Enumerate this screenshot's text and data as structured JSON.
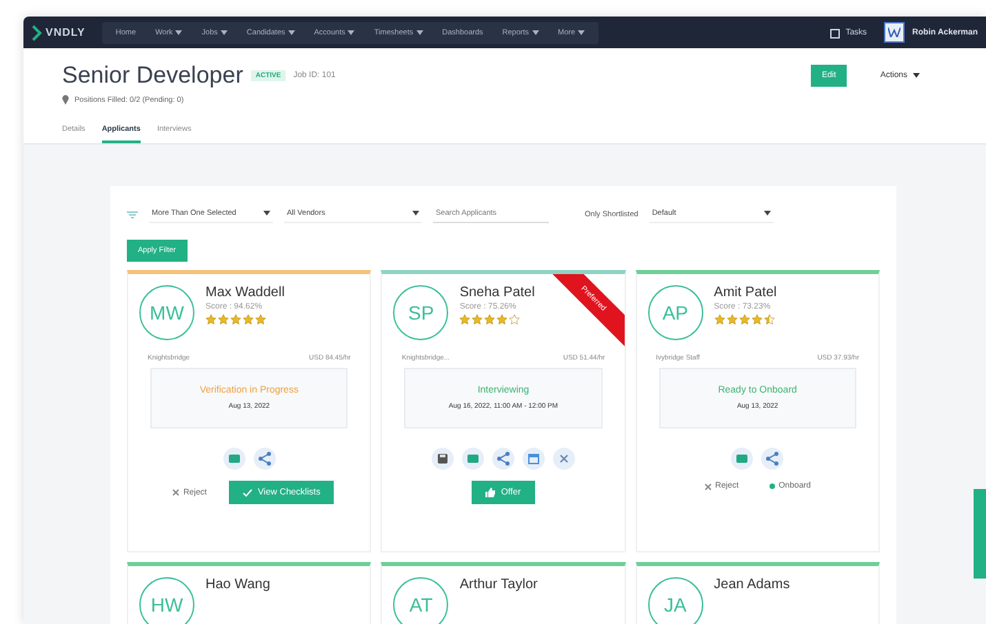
{
  "nav": {
    "logo": "VNDLY",
    "items": [
      {
        "label": "Home",
        "dropdown": false
      },
      {
        "label": "Work",
        "dropdown": true
      },
      {
        "label": "Jobs",
        "dropdown": true
      },
      {
        "label": "Candidates",
        "dropdown": true
      },
      {
        "label": "Accounts",
        "dropdown": true
      },
      {
        "label": "Timesheets",
        "dropdown": true
      },
      {
        "label": "Dashboards",
        "dropdown": false
      },
      {
        "label": "Reports",
        "dropdown": true
      },
      {
        "label": "More",
        "dropdown": true
      }
    ],
    "tasks": "Tasks",
    "user": "Robin Ackerman"
  },
  "header": {
    "title": "Senior Developer",
    "status": "ACTIVE",
    "job_id": "Job ID: 101",
    "positions": "Positions Filled: 0/2 (Pending: 0)",
    "edit": "Edit",
    "actions": "Actions"
  },
  "tabs": [
    {
      "label": "Details",
      "selected": false
    },
    {
      "label": "Applicants",
      "selected": true
    },
    {
      "label": "Interviews",
      "selected": false
    }
  ],
  "filters": {
    "statuses": "More Than One Selected",
    "vendors": "All Vendors",
    "search": {
      "placeholder": "Search Applicants"
    },
    "shortlisted": "Only Shortlisted",
    "sort": "Default",
    "apply": "Apply Filter"
  },
  "applicants": [
    {
      "initials": "MW",
      "name": "Max Waddell",
      "score": "Score : 94.62%",
      "stars": 5,
      "color": "#f5c27a",
      "location": "Knightsbridge",
      "rate": "USD 84.45/hr",
      "status": {
        "label": "Verification in Progress",
        "color": "#f0a040",
        "date": "Aug 13, 2022"
      },
      "icons": [
        {
          "kind": "email"
        },
        {
          "kind": "share"
        }
      ],
      "actions": [
        {
          "kind": "reject",
          "label": "Reject"
        },
        {
          "kind": "checklist",
          "label": "View Checklists"
        }
      ]
    },
    {
      "initials": "SP",
      "name": "Sneha Patel",
      "score": "Score : 75.26%",
      "stars": 4,
      "color": "#8fd3c3",
      "location": "Knightsbridge...",
      "rate": "USD 51.44/hr",
      "status": {
        "label": "Interviewing",
        "color": "#3cb371",
        "date": "Aug 16, 2022, 11:00 AM - 12:00 PM"
      },
      "ribbon": "Preferred",
      "icons": [
        {
          "kind": "save"
        },
        {
          "kind": "email"
        },
        {
          "kind": "share"
        },
        {
          "kind": "calendar"
        },
        {
          "kind": "close"
        }
      ],
      "actions": [
        {
          "kind": "offer",
          "label": "Offer"
        }
      ]
    },
    {
      "initials": "AP",
      "name": "Amit Patel",
      "score": "Score : 73.23%",
      "stars": 4.5,
      "color": "#6fcf97",
      "location": "Ivybridge Staff",
      "rate": "USD 37.93/hr",
      "status": {
        "label": "Ready to Onboard",
        "color": "#3cb371",
        "date": "Aug 13, 2022"
      },
      "icons": [
        {
          "kind": "email"
        },
        {
          "kind": "share"
        }
      ],
      "actions": [
        {
          "kind": "reject",
          "label": "Reject"
        },
        {
          "kind": "onboard",
          "label": "Onboard"
        }
      ]
    },
    {
      "initials": "HW",
      "name": "Hao Wang",
      "color": "#6fcf97"
    },
    {
      "initials": "AT",
      "name": "Arthur Taylor",
      "color": "#6fcf97"
    },
    {
      "initials": "JA",
      "name": "Jean Adams",
      "color": "#6fcf97"
    }
  ]
}
